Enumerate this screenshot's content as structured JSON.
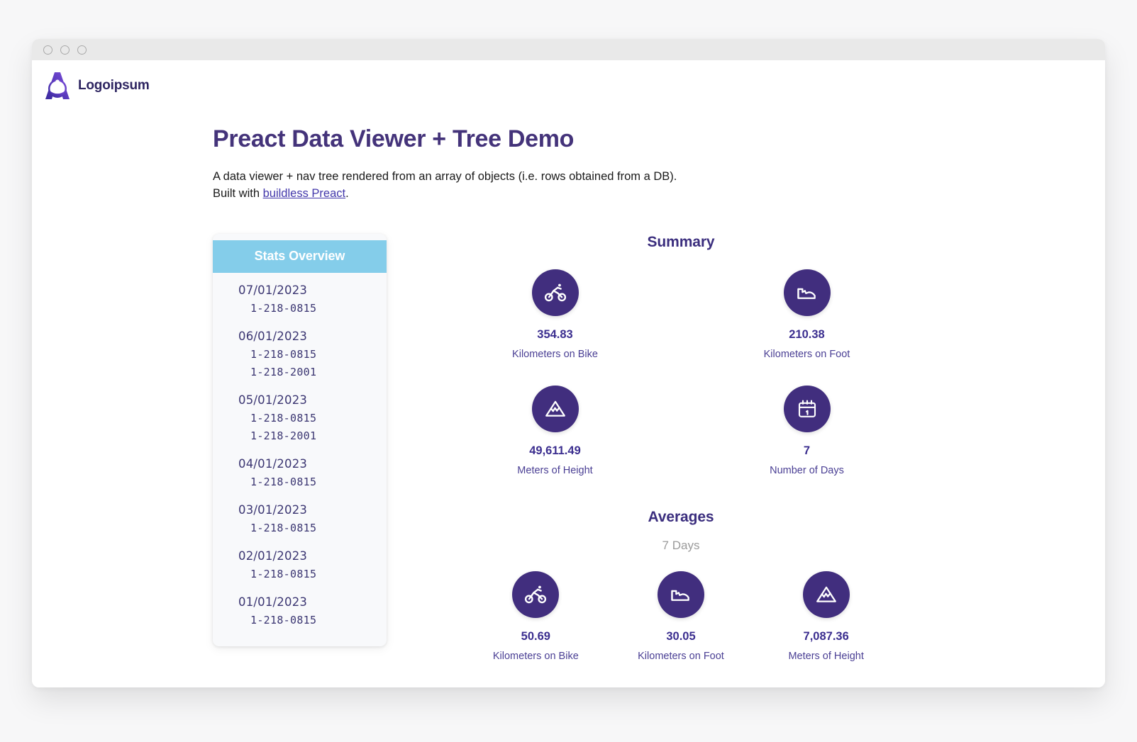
{
  "window": {
    "dots": [
      "close-dot",
      "minimize-dot",
      "maximize-dot"
    ]
  },
  "brand": {
    "name": "Logoipsum",
    "logo_icon": "logoipsum-mark",
    "logo_gradient_from": "#7c4ddb",
    "logo_gradient_to": "#3a2a9e"
  },
  "page": {
    "title": "Preact Data Viewer + Tree Demo",
    "desc_line1": "A data viewer + nav tree rendered from an array of objects (i.e. rows obtained from a DB).",
    "desc_line2_prefix": "Built with ",
    "desc_link": "buildless Preact",
    "desc_line2_suffix": "."
  },
  "tree": {
    "header": "Stats Overview",
    "groups": [
      {
        "date": "07/01/2023",
        "items": [
          "1-218-0815"
        ]
      },
      {
        "date": "06/01/2023",
        "items": [
          "1-218-0815",
          "1-218-2001"
        ]
      },
      {
        "date": "05/01/2023",
        "items": [
          "1-218-0815",
          "1-218-2001"
        ]
      },
      {
        "date": "04/01/2023",
        "items": [
          "1-218-0815"
        ]
      },
      {
        "date": "03/01/2023",
        "items": [
          "1-218-0815"
        ]
      },
      {
        "date": "02/01/2023",
        "items": [
          "1-218-0815"
        ]
      },
      {
        "date": "01/01/2023",
        "items": [
          "1-218-0815"
        ]
      }
    ]
  },
  "summary": {
    "title": "Summary",
    "stats": [
      {
        "icon": "bike-icon",
        "value": "354.83",
        "label": "Kilometers on Bike"
      },
      {
        "icon": "shoe-icon",
        "value": "210.38",
        "label": "Kilometers on Foot"
      },
      {
        "icon": "mountain-icon",
        "value": "49,611.49",
        "label": "Meters of Height"
      },
      {
        "icon": "calendar-icon",
        "value": "7",
        "label": "Number of Days"
      }
    ]
  },
  "averages": {
    "title": "Averages",
    "subtitle": "7 Days",
    "stats": [
      {
        "icon": "bike-icon",
        "value": "50.69",
        "label": "Kilometers on Bike"
      },
      {
        "icon": "shoe-icon",
        "value": "30.05",
        "label": "Kilometers on Foot"
      },
      {
        "icon": "mountain-icon",
        "value": "7,087.36",
        "label": "Meters of Height"
      }
    ]
  },
  "colors": {
    "accent_purple": "#412e7e",
    "heading_purple": "#44337a",
    "tree_header_blue": "#84cdea",
    "card_background": "#f8f9fb",
    "muted_gray": "#9b9b9b"
  }
}
